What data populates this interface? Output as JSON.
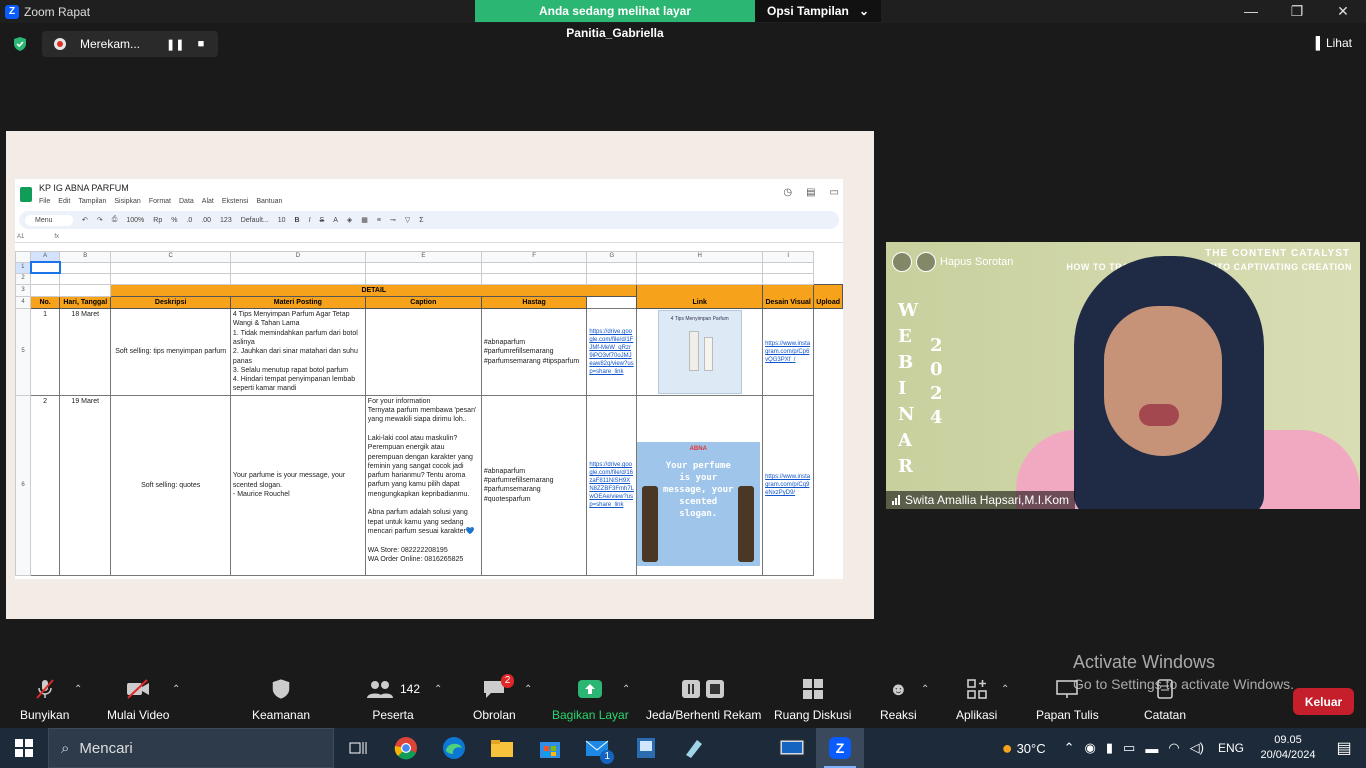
{
  "window": {
    "title": "Zoom Rapat",
    "banner": "Anda sedang melihat layar Panitia_Gabriella",
    "view_options": "Opsi Tampilan"
  },
  "recording": {
    "label": "Merekam..."
  },
  "lihat": "Lihat",
  "sheet": {
    "title": "KP IG ABNA PARFUM",
    "menus": [
      "File",
      "Edit",
      "Tampilan",
      "Sisipkan",
      "Format",
      "Data",
      "Alat",
      "Ekstensi",
      "Bantuan"
    ],
    "toolbar": {
      "search": "Menu",
      "zoom": "100%",
      "font": "Default...",
      "size": "10",
      "sum": "Σ",
      "currency": "Rp",
      "percent": "%",
      "dec1": ".0",
      "dec2": ".00",
      "num": "123"
    },
    "cellref": "A1",
    "fx": "fx",
    "columns": [
      "A",
      "B",
      "C",
      "D",
      "E",
      "F",
      "G",
      "H",
      "I"
    ],
    "rows": [
      "1",
      "2",
      "3",
      "4",
      "5",
      "6"
    ],
    "header": {
      "detail": "DETAIL",
      "no": "No.",
      "date": "Hari, Tanggal",
      "desc": "Deskripsi",
      "materi": "Materi Posting",
      "caption": "Caption",
      "hastag": "Hastag",
      "link": "Link",
      "desain": "Desain Visual",
      "upload": "Upload"
    },
    "row1": {
      "no": "1",
      "date": "18 Maret",
      "desc": "Soft selling: tips menyimpan parfum",
      "materi": "4 Tips Menyimpan Parfum Agar Tetap Wangi & Tahan Lama\n1. Tidak memindahkan parfum dari botol aslinya\n2. Jauhkan dari sinar matahari dan suhu panas\n3. Selalu menutup rapat botol parfum\n4. Hindari tempat penyimpanan lembab seperti kamar mandi",
      "caption": "",
      "hastag": "#abnaparfum #parfumrefillsemarang #parfumsemarang #tipsparfum",
      "link": "https://drive.google.com/file/d/1FJMf-MeW_qRzr9iPO3vf70oJMJeaw82q/view?usp=share_link",
      "design_title": "4 Tips Menyimpan Parfum",
      "upload": "https://www.instagram.com/p/Cp6vQG3PXf_/"
    },
    "row2": {
      "no": "2",
      "date": "19 Maret",
      "desc": "Soft selling: quotes",
      "materi": "Your parfume is your message, your scented slogan.\n- Maurice Rouchel",
      "caption": "For your information\nTernyata parfum membawa 'pesan' yang mewakili siapa dirimu loh..\n\nLaki-laki cool atau maskulin? Perempuan energik atau perempuan dengan karakter yang feminin yang sangat cocok jadi parfum harianmu? Tentu aroma parfum yang kamu pilih dapat mengungkapkan kepribadianmu.\n\nAbna parfum adalah solusi yang tepat untuk kamu yang sedang mencari parfum sesuai karakter💙\n\nWA Store: 082222208195\nWA Order Online: 0816265825",
      "hastag": "#abnaparfum #parfumrefillsemarang #parfumsemarang #quotesparfum",
      "link": "https://drive.google.com/file/d/16zaF811NiSH9XN8ZZBF3Fmh7LwOEAe/view?usp=share_link",
      "design_brand": "ABNA",
      "design_quote": "Your perfume is your message, your scented slogan.",
      "upload": "https://www.instagram.com/p/Cq9eNxzPyD9/"
    }
  },
  "video": {
    "top1": "THE CONTENT CATALYST",
    "top2": "HOW TO TRANSFORM IDEAS INTO CAPTIVATING CREATION",
    "webinar": [
      "W",
      "E",
      "B",
      "I",
      "N",
      "A",
      "R"
    ],
    "year": [
      "2",
      "0",
      "2",
      "4"
    ],
    "overlay": "Hapus Sorotan",
    "name": "Swita Amallia Hapsari,M.I.Kom"
  },
  "watermark": {
    "line1": "Activate Windows",
    "line2": "Go to Settings to activate Windows."
  },
  "controls": {
    "audio": "Bunyikan",
    "video": "Mulai Video",
    "security": "Keamanan",
    "participants": "Peserta",
    "participants_count": "142",
    "chat": "Obrolan",
    "chat_badge": "2",
    "share": "Bagikan Layar",
    "pause_rec": "Jeda/Berhenti Rekam",
    "breakout": "Ruang Diskusi",
    "reactions": "Reaksi",
    "apps": "Aplikasi",
    "whiteboard": "Papan Tulis",
    "notes": "Catatan",
    "leave": "Keluar"
  },
  "taskbar": {
    "search": "Mencari",
    "weather": "30°C",
    "lang": "ENG",
    "time": "09.05",
    "date": "20/04/2024",
    "mail_badge": "1"
  },
  "colors": {
    "accent_green": "#2bb673",
    "header_orange": "#f6a21a",
    "leave_red": "#c41f2a",
    "zoom_blue": "#0b5cff"
  }
}
